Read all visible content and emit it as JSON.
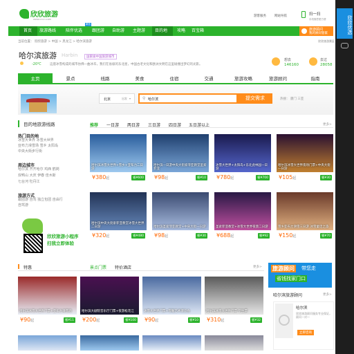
{
  "header": {
    "logo_text": "欣欣旅游",
    "logo_sub": "www.cncn.com",
    "top_links": [
      "游客服务",
      "网站导航"
    ],
    "sweep": "扫一扫",
    "sweep_sub": "手机随意更方便"
  },
  "nav": {
    "items": [
      "首页",
      "旅游路线",
      "陪伴优选",
      "跟团游",
      "自助游",
      "主题游",
      "目的地",
      "攻略",
      "百宝箱"
    ],
    "badge": "新品",
    "advisor_label": "旅游顾问",
    "advisor_sub": "我的顾问管家"
  },
  "breadcrumb": [
    "当前位置：",
    "欣欣旅游",
    "中国",
    "黑龙江",
    "哈尔滨旅游"
  ],
  "city": {
    "name": "哈尔滨旅游",
    "pinyin": "Harbin",
    "tag": "国家级中国旅游城市",
    "weather": "-20℃",
    "desc": "这座冰雪构成的城市仿佛一曲冰华，我们在省级的东北星，中国古老文化和欧洲文明在这里碰撞出梦幻的光影。",
    "wanted_label": "想去",
    "wanted_count": "146160",
    "visited_label": "去过",
    "visited_count": "28058",
    "right_note": "欣欣旅游景区点"
  },
  "tabs": [
    "主页",
    "景点",
    "线路",
    "美食",
    "住宿",
    "交通",
    "旅游攻略",
    "旅游顾问",
    "指南"
  ],
  "search": {
    "from": "北京",
    "from_sub": "出发",
    "to": "哈尔滨",
    "button": "提交需求",
    "hot_label": "热搜：",
    "hot": [
      "厦门",
      "三亚"
    ]
  },
  "sidebar": {
    "title": "目的地旅游线路",
    "sections": [
      {
        "title": "热门目的地",
        "lines": [
          "冰雪大世界 冰雪大世界",
          "亚布力滑雪场 雪乡 太阳岛",
          "中央大街步行街"
        ]
      },
      {
        "title": "周边城市",
        "lines": [
          "哈尔滨 齐齐哈尔 鸡西 鹤岗",
          "双鸭山 大庆 伊春 佳木斯",
          "七台河 牡丹江"
        ]
      },
      {
        "title": "旅游方式",
        "lines": [
          "跟团游 自驾 独立包团 自由行",
          "自驾游"
        ]
      }
    ],
    "mini_app_1": "欣欣旅游小程序",
    "mini_app_2": "扫我立即体验"
  },
  "route_tabs": {
    "items": [
      "推荐",
      "一日游",
      "两日游",
      "三日游",
      "四日游",
      "五日游以上"
    ],
    "more": "更多>"
  },
  "routes": [
    {
      "title": "哈尔滨冰雪大世界+雪乡+亚布力二日游",
      "price": "380",
      "btn": "省¥600",
      "color1": "#2a5d9c",
      "color2": "#9ec9ef"
    },
    {
      "title": "哈尔滨一日游中央大街索菲亚教堂圣索菲亚",
      "price": "98",
      "btn": "省¥10",
      "color1": "#1f3f6e",
      "color2": "#7aa6d8"
    },
    {
      "title": "冰雪大世界+太阳岛+东北虎林园一日游",
      "price": "780",
      "btn": "省¥700",
      "color1": "#1a1a4e",
      "color2": "#5566cc"
    },
    {
      "title": "哈尔滨冰雪大世界夜场门票+中央大街一日游",
      "price": "105",
      "btn": "省¥30",
      "color1": "#2a1030",
      "color2": "#c08030"
    },
    {
      "title": "哈尔滨中央大街索菲亚教堂冰雪大世界二日游",
      "price": "320",
      "btn": "省¥480",
      "color1": "#223355",
      "color2": "#6688bb"
    },
    {
      "title": "哈尔滨圣索菲亚教堂+中央大街一日游",
      "price": "98",
      "btn": "省¥30",
      "color1": "#3a4a70",
      "color2": "#a8bce0"
    },
    {
      "title": "圣索菲亚教堂+冰雪大世界夜景二日游",
      "price": "688",
      "btn": "省¥92",
      "color1": "#281844",
      "color2": "#c050a0"
    },
    {
      "title": "雪乡亚布力滑雪三日游 冰雪童话之旅",
      "price": "150",
      "btn": "省¥70",
      "color1": "#6a3a2a",
      "color2": "#e0b080"
    }
  ],
  "special": {
    "title": "特惠",
    "tabs": [
      "景点门票",
      "特价酒店"
    ],
    "more": "更多>",
    "items": [
      {
        "title": "哈尔滨冰雪大世界门票+亚布力滑雪场",
        "price": "90",
        "btn": "省¥11",
        "color1": "#9a2a2a",
        "color2": "#e8eef6"
      },
      {
        "title": "哈尔滨大剧院音乐厅门票+夜游松花江",
        "price": "200",
        "btn": "省¥100",
        "color1": "#4a1050",
        "color2": "#1a1a30"
      },
      {
        "title": "冰雪大世界门票+雪雕艺术博览会",
        "price": "90",
        "btn": "省¥10",
        "color1": "#4a6aa0",
        "color2": "#dde6f4"
      },
      {
        "title": "哈尔滨冰雪大世界门票 学生票",
        "price": "310",
        "btn": "省¥32",
        "color1": "#5a5a5a",
        "color2": "#e6e6e6"
      }
    ]
  },
  "advisor_ad": {
    "line1": "旅游顾问",
    "line2": "带您走",
    "line3": "省钱找家门口",
    "sub": "哈尔滨旅游顾问",
    "name": "哈尔滨",
    "desc": "欣欣旅游顾问服务专业保证，顾问一对一",
    "btn": "立即咨询",
    "more": "更多>"
  },
  "rside": {
    "text": "欣欣优选",
    "text2": "旅游"
  }
}
